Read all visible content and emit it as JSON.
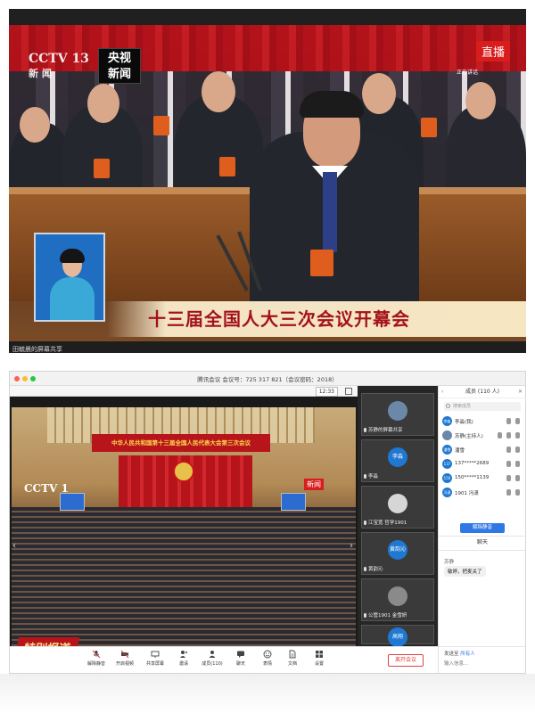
{
  "broadcast": {
    "cctv_logo": "CCTV 13",
    "cctv_sub": "新 闻",
    "channel_logo": "央视\n新闻",
    "live_label": "直播",
    "speaking_note": "正在讲话",
    "subtitle": "十三届全国人大三次会议开幕会",
    "share_caption": "田毓晨的屏幕共享"
  },
  "meeting": {
    "title": "腾讯会议 会议号：725 317 821（会议密码：2018）",
    "clock": "12:33",
    "hall_banner": "中华人民共和国第十三届全国人民代表大会第三次会议",
    "hall_cctv": "CCTV 1",
    "hall_live": "新闻",
    "special_report": "特别报道",
    "participant_tiles": [
      {
        "avatar": "",
        "name": "苏静的屏幕共享",
        "mic_off": false
      },
      {
        "avatar": "李淼",
        "name": "李淼",
        "mic_off": false
      },
      {
        "avatar": "",
        "name": "江宝宽 哲学1901",
        "mic_off": false
      },
      {
        "avatar": "黄韵沁",
        "name": "黄韵沁",
        "mic_off": false
      },
      {
        "avatar": "",
        "name": "公管1901 金雪妍",
        "mic_off": false
      },
      {
        "avatar": "高翔",
        "name": "",
        "mic_off": false
      }
    ],
    "members_panel": {
      "header": "成员 (110 人)",
      "search_placeholder": "搜索成员",
      "members": [
        {
          "avatar": "李淼",
          "name": "李淼(我)",
          "mic_red": false
        },
        {
          "avatar": "",
          "name": "苏静(主持人)",
          "mic_red": false
        },
        {
          "avatar": "潘雪",
          "name": "潘雪",
          "mic_red": false
        },
        {
          "avatar": "137",
          "name": "137*****2689",
          "mic_red": false
        },
        {
          "avatar": "150",
          "name": "150*****1139",
          "mic_red": false
        },
        {
          "avatar": "冯潇",
          "name": "1901 冯潇",
          "mic_red": false
        }
      ],
      "mute_all_button": "解除静音",
      "chat_header": "聊天",
      "chat_sender": "苏静",
      "chat_message": "敏婷，把麦关了",
      "send_to_label": "发送至",
      "send_to_target": "所有人",
      "chat_placeholder": "输入信息..."
    },
    "toolbar": [
      {
        "label": "解除静音",
        "icon": "mic-muted-icon"
      },
      {
        "label": "开启视频",
        "icon": "camera-off-icon"
      },
      {
        "label": "共享屏幕",
        "icon": "screen-share-icon"
      },
      {
        "label": "邀请",
        "icon": "invite-icon"
      },
      {
        "label": "成员(110)",
        "icon": "members-icon"
      },
      {
        "label": "聊天",
        "icon": "chat-icon"
      },
      {
        "label": "表情",
        "icon": "emoji-icon"
      },
      {
        "label": "文档",
        "icon": "document-icon"
      },
      {
        "label": "设置",
        "icon": "settings-icon"
      }
    ],
    "leave_button": "离开会议",
    "colors": {
      "accent": "#2f78e6",
      "leave": "#e24242",
      "broadcast_red": "#b8151b"
    }
  }
}
